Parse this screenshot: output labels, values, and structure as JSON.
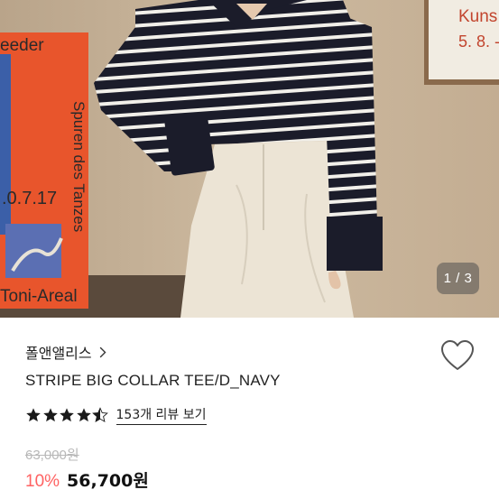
{
  "gallery": {
    "page_indicator": "1 / 3",
    "poster_left": {
      "lines": [
        "eeder",
        "Spuren des Tanzes",
        ".0.7.17",
        "Toni-Areal"
      ]
    },
    "poster_right": {
      "lines": [
        "Kuns",
        "5. 8. -"
      ]
    },
    "colors": {
      "wall": "#c9b59c",
      "poster_orange": "#e8552c",
      "stripe_navy": "#1b1c2a",
      "pants": "#ece4d5"
    }
  },
  "product": {
    "brand": "폴앤앨리스",
    "title": "STRIPE BIG COLLAR TEE/D_NAVY",
    "rating": 4.5,
    "review_link": "153개 리뷰 보기",
    "original_price": "63,000원",
    "discount": "10%",
    "sale_price": "56,700원"
  },
  "icons": {
    "brand_chevron": "chevron-right-icon",
    "wishlist": "heart-outline-icon",
    "star_full": "star-icon",
    "star_half": "star-half-icon"
  }
}
